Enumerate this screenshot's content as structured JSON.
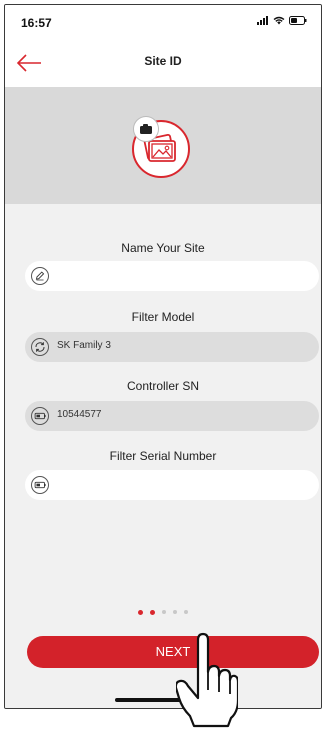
{
  "status_bar": {
    "time": "16:57"
  },
  "header": {
    "title": "Site ID"
  },
  "form": {
    "name_label": "Name Your Site",
    "name_value": "",
    "filter_model_label": "Filter Model",
    "filter_model_value": "SK Family 3",
    "controller_sn_label": "Controller SN",
    "controller_sn_value": "10544577",
    "filter_serial_label": "Filter Serial Number",
    "filter_serial_value": ""
  },
  "pager": {
    "total": 5,
    "active_index": 1
  },
  "next_button": {
    "label": "NEXT"
  },
  "colors": {
    "accent": "#d3222a",
    "hero_bg": "#d9d9d9",
    "form_bg": "#f1f1f1"
  }
}
